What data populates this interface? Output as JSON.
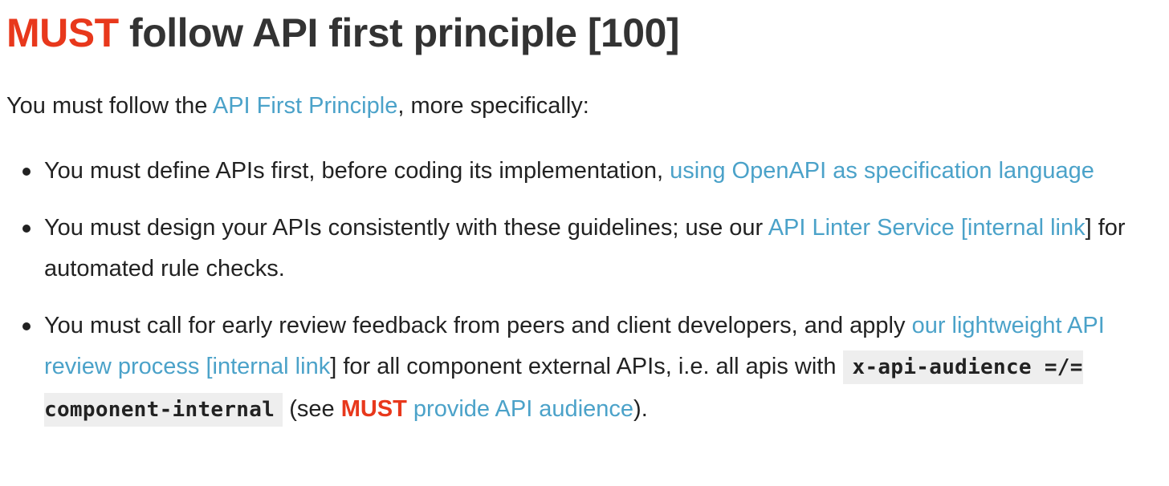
{
  "heading": {
    "must": "MUST",
    "title": " follow API first principle [100]"
  },
  "intro": {
    "before": "You must follow the ",
    "link": "API First Principle",
    "after": ", more specifically:"
  },
  "items": [
    {
      "text_before": "You must define APIs first, before coding its implementation, ",
      "link": "using OpenAPI as specification language"
    },
    {
      "text_before": "You must design your APIs consistently with these guidelines; use our ",
      "link": "API Linter Service [internal link",
      "text_after": "] for automated rule checks."
    },
    {
      "text_before": "You must call for early review feedback from peers and client developers, and apply ",
      "link": "our lightweight API review process [internal link",
      "text_mid": "] for all component external APIs, i.e. all apis with ",
      "code": "x-api-audience =/= component-internal",
      "see_open": " (see ",
      "must": "MUST",
      "see_link": " provide API audience",
      "close": ")."
    }
  ],
  "colors": {
    "must": "#e8381c",
    "link": "#4ba2c9",
    "heading": "#333333",
    "text": "#222222",
    "code_background": "#eeeeee"
  }
}
